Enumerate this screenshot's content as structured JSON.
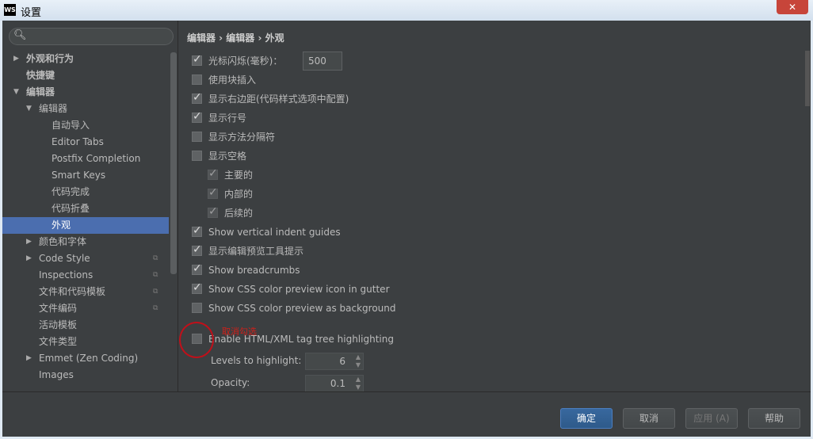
{
  "window": {
    "title": "设置",
    "logo": "WS",
    "close": "✕"
  },
  "search": {
    "icon": "search-icon",
    "value": ""
  },
  "tree": [
    {
      "label": "外观和行为",
      "indent": 0,
      "arrow": "▶",
      "bold": true
    },
    {
      "label": "快捷键",
      "indent": 0,
      "arrow": "",
      "bold": true
    },
    {
      "label": "编辑器",
      "indent": 0,
      "arrow": "▼",
      "bold": true
    },
    {
      "label": "编辑器",
      "indent": 1,
      "arrow": "▼"
    },
    {
      "label": "自动导入",
      "indent": 2,
      "arrow": ""
    },
    {
      "label": "Editor Tabs",
      "indent": 2,
      "arrow": ""
    },
    {
      "label": "Postfix Completion",
      "indent": 2,
      "arrow": ""
    },
    {
      "label": "Smart Keys",
      "indent": 2,
      "arrow": ""
    },
    {
      "label": "代码完成",
      "indent": 2,
      "arrow": ""
    },
    {
      "label": "代码折叠",
      "indent": 2,
      "arrow": ""
    },
    {
      "label": "外观",
      "indent": 2,
      "arrow": "",
      "selected": true
    },
    {
      "label": "颜色和字体",
      "indent": 1,
      "arrow": "▶"
    },
    {
      "label": "Code Style",
      "indent": 1,
      "arrow": "▶",
      "copy": true
    },
    {
      "label": "Inspections",
      "indent": 1,
      "arrow": "",
      "copy": true
    },
    {
      "label": "文件和代码模板",
      "indent": 1,
      "arrow": "",
      "copy": true
    },
    {
      "label": "文件编码",
      "indent": 1,
      "arrow": "",
      "copy": true
    },
    {
      "label": "活动模板",
      "indent": 1,
      "arrow": ""
    },
    {
      "label": "文件类型",
      "indent": 1,
      "arrow": ""
    },
    {
      "label": "Emmet (Zen Coding)",
      "indent": 1,
      "arrow": "▶"
    },
    {
      "label": "Images",
      "indent": 1,
      "arrow": ""
    }
  ],
  "breadcrumb": "编辑器 › 编辑器 › 外观",
  "options": [
    {
      "label": "光标闪烁(毫秒)：",
      "checked": true,
      "value": "500"
    },
    {
      "label": "使用块插入",
      "checked": false
    },
    {
      "label": "显示右边距(代码样式选项中配置)",
      "checked": true
    },
    {
      "label": "显示行号",
      "checked": true
    },
    {
      "label": "显示方法分隔符",
      "checked": false
    },
    {
      "label": "显示空格",
      "checked": false
    },
    {
      "label": "主要的",
      "checked": true,
      "sub": true
    },
    {
      "label": "内部的",
      "checked": true,
      "sub": true
    },
    {
      "label": "后续的",
      "checked": true,
      "sub": true
    },
    {
      "label": "Show vertical indent guides",
      "checked": true
    },
    {
      "label": "显示编辑预览工具提示",
      "checked": true
    },
    {
      "label": "Show breadcrumbs",
      "checked": true
    },
    {
      "label": "Show CSS color preview icon in gutter",
      "checked": true
    },
    {
      "label": "Show CSS color preview as background",
      "checked": false
    },
    {
      "label": "Enable HTML/XML tag tree highlighting",
      "checked": false
    }
  ],
  "levels": {
    "label": "Levels to highlight:",
    "value": "6"
  },
  "opacity": {
    "label": "Opacity:",
    "value": "0.1"
  },
  "annotation": "取消勾选",
  "buttons": {
    "ok": "确定",
    "cancel": "取消",
    "apply": "应用 (A)",
    "help": "帮助"
  }
}
